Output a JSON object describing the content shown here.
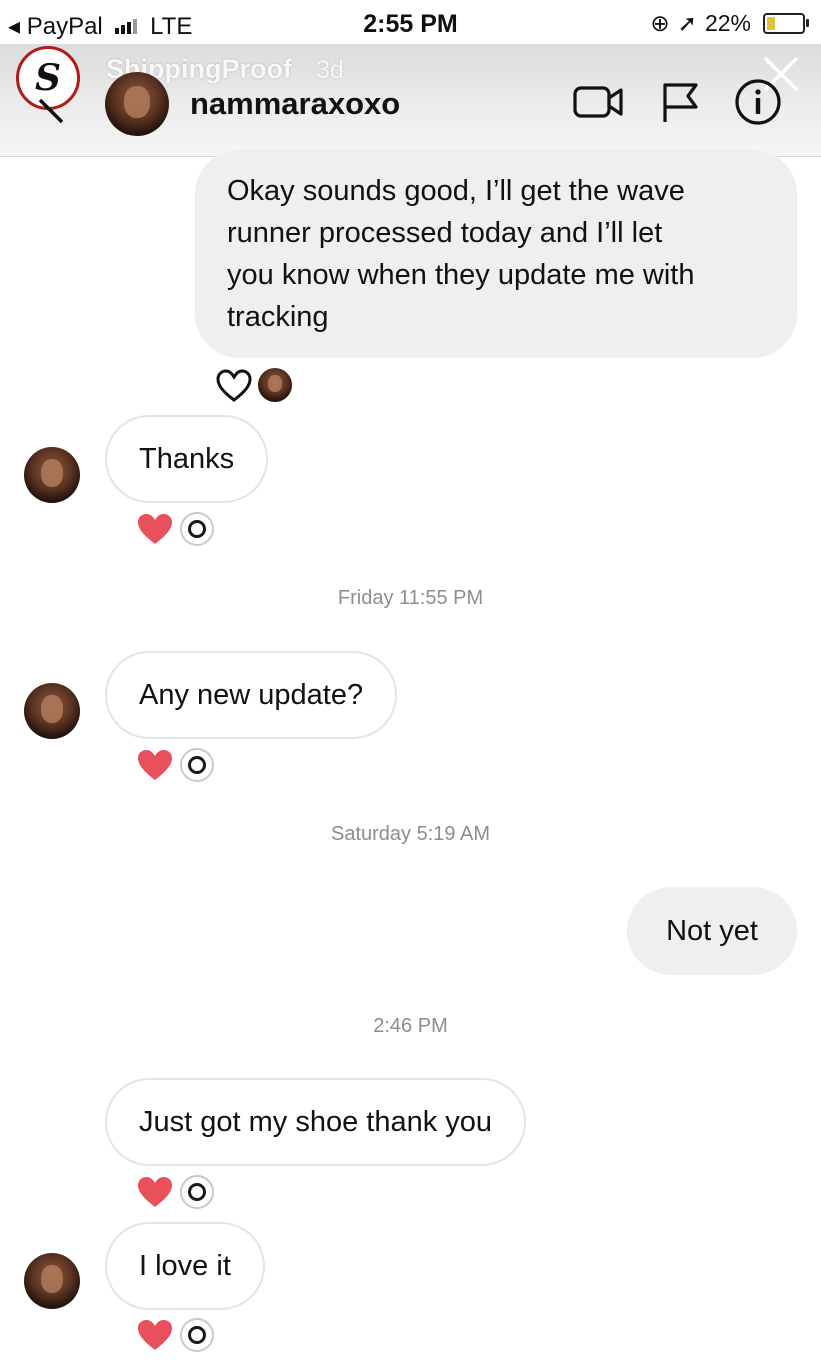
{
  "status_bar": {
    "carrier": "◂ PayPal",
    "network": "LTE",
    "time": "2:55 PM",
    "battery": "22%",
    "battery_level": 0.22
  },
  "story": {
    "account": "ShippingProof",
    "age": "3d"
  },
  "conversation": {
    "username": "nammaraxoxo",
    "header_icons": [
      "video-call-icon",
      "flag-icon",
      "info-icon"
    ]
  },
  "messages": [
    {
      "direction": "out",
      "text": "Okay sounds good, I’ll get the wave runner processed today and I’ll let you know when they update me with tracking",
      "lines": [
        "Okay sounds good, I’ll get the wave",
        "runner processed today and I’ll let",
        "you know when they update me with",
        "tracking"
      ],
      "reaction": "heart-outline"
    },
    {
      "direction": "in",
      "text": "Thanks",
      "reaction": "heart-red"
    },
    {
      "direction": "timestamp",
      "text": "Friday 11:55 PM"
    },
    {
      "direction": "in",
      "text": "Any new update?",
      "reaction": "heart-red"
    },
    {
      "direction": "timestamp",
      "text": "Saturday 5:19 AM"
    },
    {
      "direction": "out",
      "text": "Not yet"
    },
    {
      "direction": "timestamp",
      "text": "2:46 PM"
    },
    {
      "direction": "in",
      "text": "Just got my shoe thank you",
      "reaction": "heart-red"
    },
    {
      "direction": "in",
      "text": "I love it",
      "reaction": "heart-red"
    }
  ],
  "colors": {
    "accent_red": "#e8505b",
    "bubble_out": "#efefef",
    "bubble_in_border": "#e4e4e4",
    "timestamp": "#8e8e8e"
  }
}
